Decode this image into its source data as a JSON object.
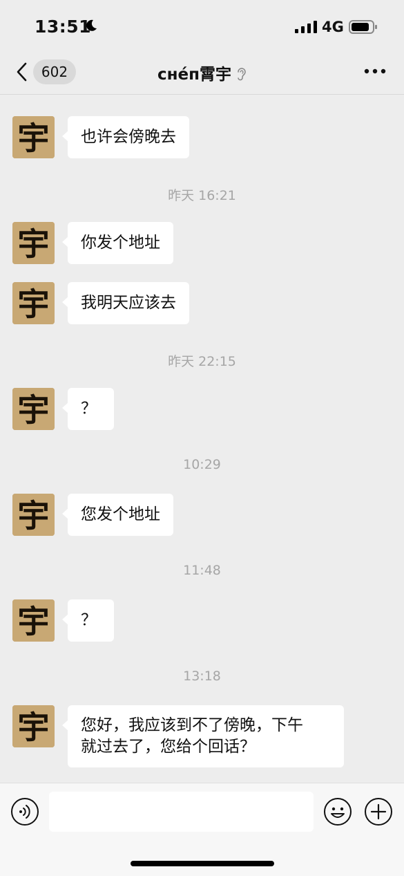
{
  "status_bar": {
    "time": "13:51",
    "network": "4G",
    "icons": [
      "moon-icon",
      "signal-icon",
      "battery-icon"
    ]
  },
  "nav": {
    "unread_count": "602",
    "title": "cнéп霄宇",
    "icons": [
      "back-icon",
      "ear-icon",
      "more-icon"
    ]
  },
  "messages": [
    {
      "type": "text",
      "text": "也许会傍晚去"
    },
    {
      "type": "time",
      "text": "昨天 16:21"
    },
    {
      "type": "text",
      "text": "你发个地址"
    },
    {
      "type": "text",
      "text": "我明天应该去"
    },
    {
      "type": "time",
      "text": "昨天 22:15"
    },
    {
      "type": "text",
      "text": "？"
    },
    {
      "type": "time",
      "text": "10:29"
    },
    {
      "type": "text",
      "text": "您发个地址"
    },
    {
      "type": "time",
      "text": "11:48"
    },
    {
      "type": "text",
      "text": "？"
    },
    {
      "type": "time",
      "text": "13:18"
    },
    {
      "type": "text",
      "text": "您好，我应该到不了傍晚，下午\n就过去了，您给个回话？"
    }
  ],
  "avatar_glyph": "宇",
  "input_bar": {
    "icons": [
      "voice-icon",
      "emoji-icon",
      "plus-icon"
    ]
  },
  "colors": {
    "background": "#ededed",
    "bubble": "#ffffff",
    "timestamp": "#a6a6a6",
    "avatar": "#c8a874"
  }
}
